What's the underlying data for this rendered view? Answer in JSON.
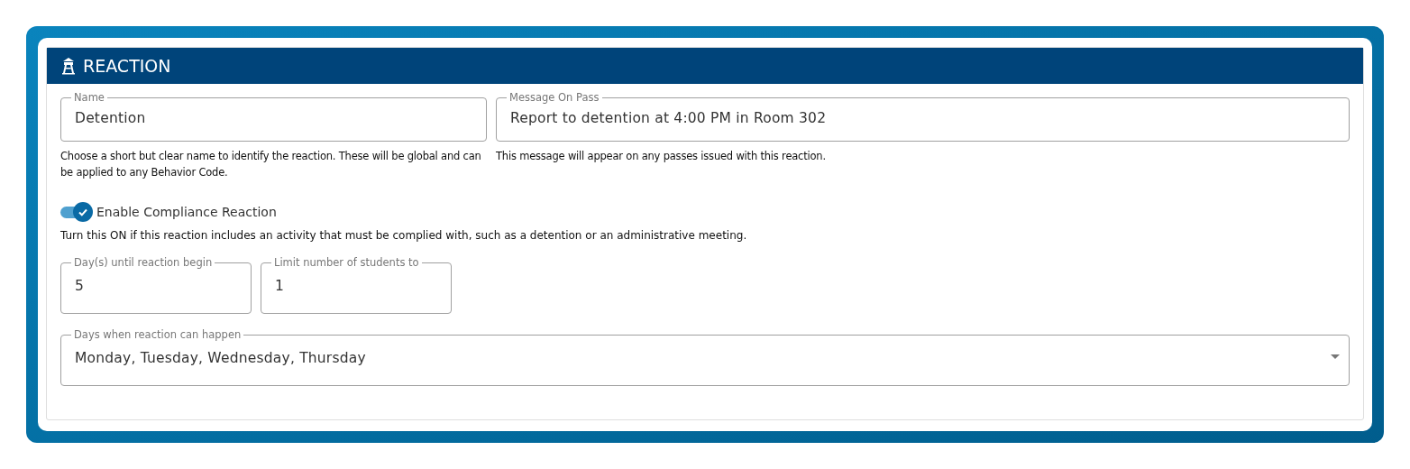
{
  "panel": {
    "title": "REACTION"
  },
  "top_fields": [
    {
      "label": "Name",
      "value": "Detention",
      "helper": "Choose a short but clear name to identify the reaction. These will be global and can be applied to any Behavior Code."
    },
    {
      "label": "Message On Pass",
      "value": "Report to detention at 4:00 PM in Room 302",
      "helper": "This message will appear on any passes issued with this reaction."
    }
  ],
  "compliance": {
    "label": "Enable Compliance Reaction",
    "on": true,
    "helper": "Turn this ON if this reaction includes an activity that must be complied with, such as a detention or an administrative meeting."
  },
  "small_fields": [
    {
      "label": "Day(s) until reaction begin",
      "value": "5"
    },
    {
      "label": "Limit number of students to",
      "value": "1"
    }
  ],
  "days_field": {
    "kind": "select",
    "label": "Days when reaction can happen",
    "value": "Monday, Tuesday, Wednesday, Thursday"
  }
}
